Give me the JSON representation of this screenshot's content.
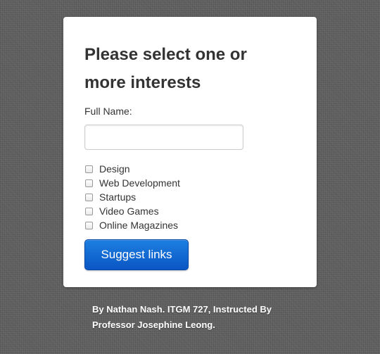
{
  "form": {
    "title": "Please select one or more interests",
    "name_label": "Full Name:",
    "name_value": "",
    "name_placeholder": "",
    "interests": [
      {
        "label": "Design",
        "checked": false
      },
      {
        "label": "Web Development",
        "checked": false
      },
      {
        "label": "Startups",
        "checked": false
      },
      {
        "label": "Video Games",
        "checked": false
      },
      {
        "label": "Online Magazines",
        "checked": false
      }
    ],
    "submit_label": "Suggest links"
  },
  "footer": {
    "credit": "By Nathan Nash. ITGM 727, Instructed By Professor Josephine Leong."
  },
  "colors": {
    "background": "#5f5f5f",
    "card": "#ffffff",
    "button": "#0a56c4",
    "text": "#333333"
  }
}
